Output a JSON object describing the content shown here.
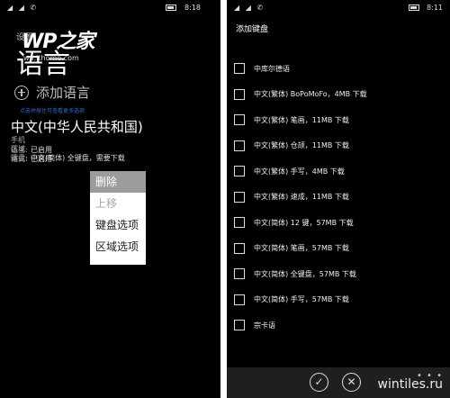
{
  "left": {
    "status": {
      "time": "8:18"
    },
    "settings_label": "设置",
    "page_title": "语言",
    "watermark": {
      "main": "WP之家",
      "sub": "wp.ithome.com"
    },
    "add_language": "添加语言",
    "hint": "点击并按住可查看更多选项",
    "language": "中文(中华人民共和国)",
    "info": [
      {
        "key": "手机语言:",
        "value": "已启用"
      },
      {
        "key": "区域格式:",
        "value": "已启用"
      },
      {
        "key": "键盘:",
        "value": "中文(简体) 全键盘，需要下载"
      }
    ],
    "context_menu": [
      {
        "label": "删除",
        "state": "selected"
      },
      {
        "label": "上移",
        "state": "disabled"
      },
      {
        "label": "键盘选项",
        "state": "normal"
      },
      {
        "label": "区域选项",
        "state": "normal"
      }
    ]
  },
  "right": {
    "status": {
      "time": "8:11"
    },
    "title": "添加键盘",
    "keyboards": [
      {
        "label": "中库尔德语",
        "checked": false
      },
      {
        "label": "中文(繁体) BoPoMoFo，4MB 下载",
        "checked": false
      },
      {
        "label": "中文(繁体) 笔画，11MB 下载",
        "checked": false
      },
      {
        "label": "中文(繁体) 仓颉，11MB 下载",
        "checked": false
      },
      {
        "label": "中文(繁体) 手写，4MB 下载",
        "checked": false
      },
      {
        "label": "中文(繁体) 速成，11MB 下载",
        "checked": false
      },
      {
        "label": "中文(简体) 12 键，57MB 下载",
        "checked": false
      },
      {
        "label": "中文(简体) 笔画，57MB 下载",
        "checked": false
      },
      {
        "label": "中文(简体) 全键盘，57MB 下载",
        "checked": false
      },
      {
        "label": "中文(简体) 手写，57MB 下载",
        "checked": false
      },
      {
        "label": "宗卡语",
        "checked": false
      }
    ],
    "appbar": {
      "more": "• • •",
      "brand": "wintiles.ru",
      "icons": [
        "check-icon",
        "cancel-icon"
      ]
    }
  },
  "colors": {
    "accent": "#2b6dc9",
    "background": "#000000",
    "menu_selected": "#9c9c9c"
  }
}
